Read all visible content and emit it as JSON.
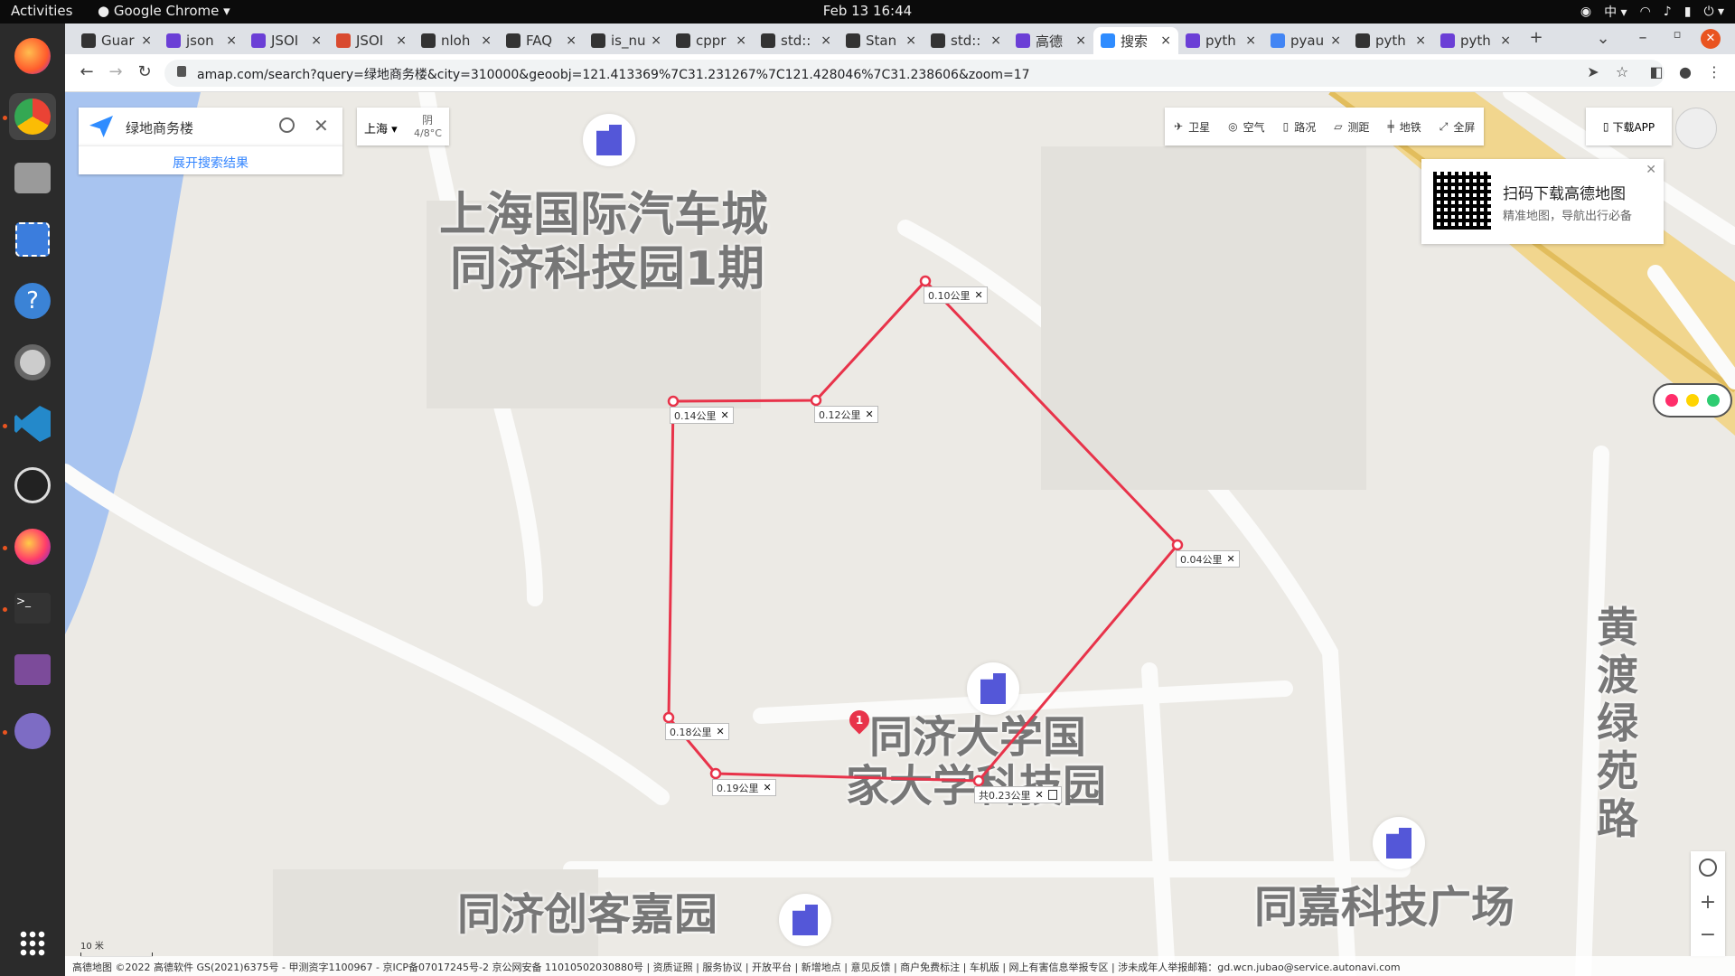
{
  "topbar": {
    "activities": "Activities",
    "app": "Google Chrome",
    "clock": "Feb 13  16:44",
    "ime": "中"
  },
  "tabs": [
    {
      "label": "Guar",
      "color": "#333"
    },
    {
      "label": "json",
      "color": "#6b3fd6"
    },
    {
      "label": "JSOI",
      "color": "#6b3fd6"
    },
    {
      "label": "JSOI",
      "color": "#d94a2f"
    },
    {
      "label": "nloh",
      "color": "#333"
    },
    {
      "label": "FAQ",
      "color": "#333"
    },
    {
      "label": "is_nu",
      "color": "#333"
    },
    {
      "label": "cppr",
      "color": "#333"
    },
    {
      "label": "std::",
      "color": "#333"
    },
    {
      "label": "Stan",
      "color": "#333"
    },
    {
      "label": "std::",
      "color": "#333"
    },
    {
      "label": "高德",
      "color": "#6b3fd6"
    },
    {
      "label": "搜索",
      "color": "#2f8cff",
      "active": true
    },
    {
      "label": "pyth",
      "color": "#6b3fd6"
    },
    {
      "label": "pyau",
      "color": "#4285f4"
    },
    {
      "label": "pyth",
      "color": "#333"
    },
    {
      "label": "pyth",
      "color": "#6b3fd6"
    }
  ],
  "url": "amap.com/search?query=绿地商务楼&city=310000&geoobj=121.413369%7C31.231267%7C121.428046%7C31.238606&zoom=17",
  "search": {
    "query": "绿地商务楼",
    "expand": "展开搜索结果"
  },
  "weather": {
    "city": "上海",
    "condition": "阴",
    "temp": "4/8°C"
  },
  "maptools": {
    "satellite": "卫星",
    "air": "空气",
    "traffic": "路况",
    "measure": "测距",
    "subway": "地铁",
    "fullscreen": "全屏",
    "download": "下载APP"
  },
  "qr": {
    "title": "扫码下载高德地图",
    "subtitle": "精准地图，导航出行必备"
  },
  "map_labels": {
    "l1": "上海国际汽车城",
    "l2": "同济科技园1期",
    "l3": "同济大学国",
    "l4": "家大学科技园",
    "l5": "同济创客嘉园",
    "l6": "同嘉科技广场",
    "road": "黄渡绿苑路"
  },
  "measures": {
    "m1": "0.10公里",
    "m2": "0.12公里",
    "m3": "0.14公里",
    "m4": "0.04公里",
    "m5": "0.18公里",
    "m6": "0.19公里",
    "m7": "共0.23公里",
    "pin": "1"
  },
  "scale": "10 米",
  "footer": "高德地图  ©2022 高德软件 GS(2021)6375号 - 甲测资字1100967 - 京ICP备07017245号-2  京公网安备 11010502030880号 | 资质证照 | 服务协议 | 开放平台 | 新增地点 | 意见反馈 | 商户免费标注 | 车机版 | 网上有害信息举报专区 | 涉未成年人举报邮箱：gd.wcn.jubao@service.autonavi.com",
  "colors": {
    "route": "#e8334a",
    "brand": "#3385ff",
    "poi": "#5457d8"
  }
}
